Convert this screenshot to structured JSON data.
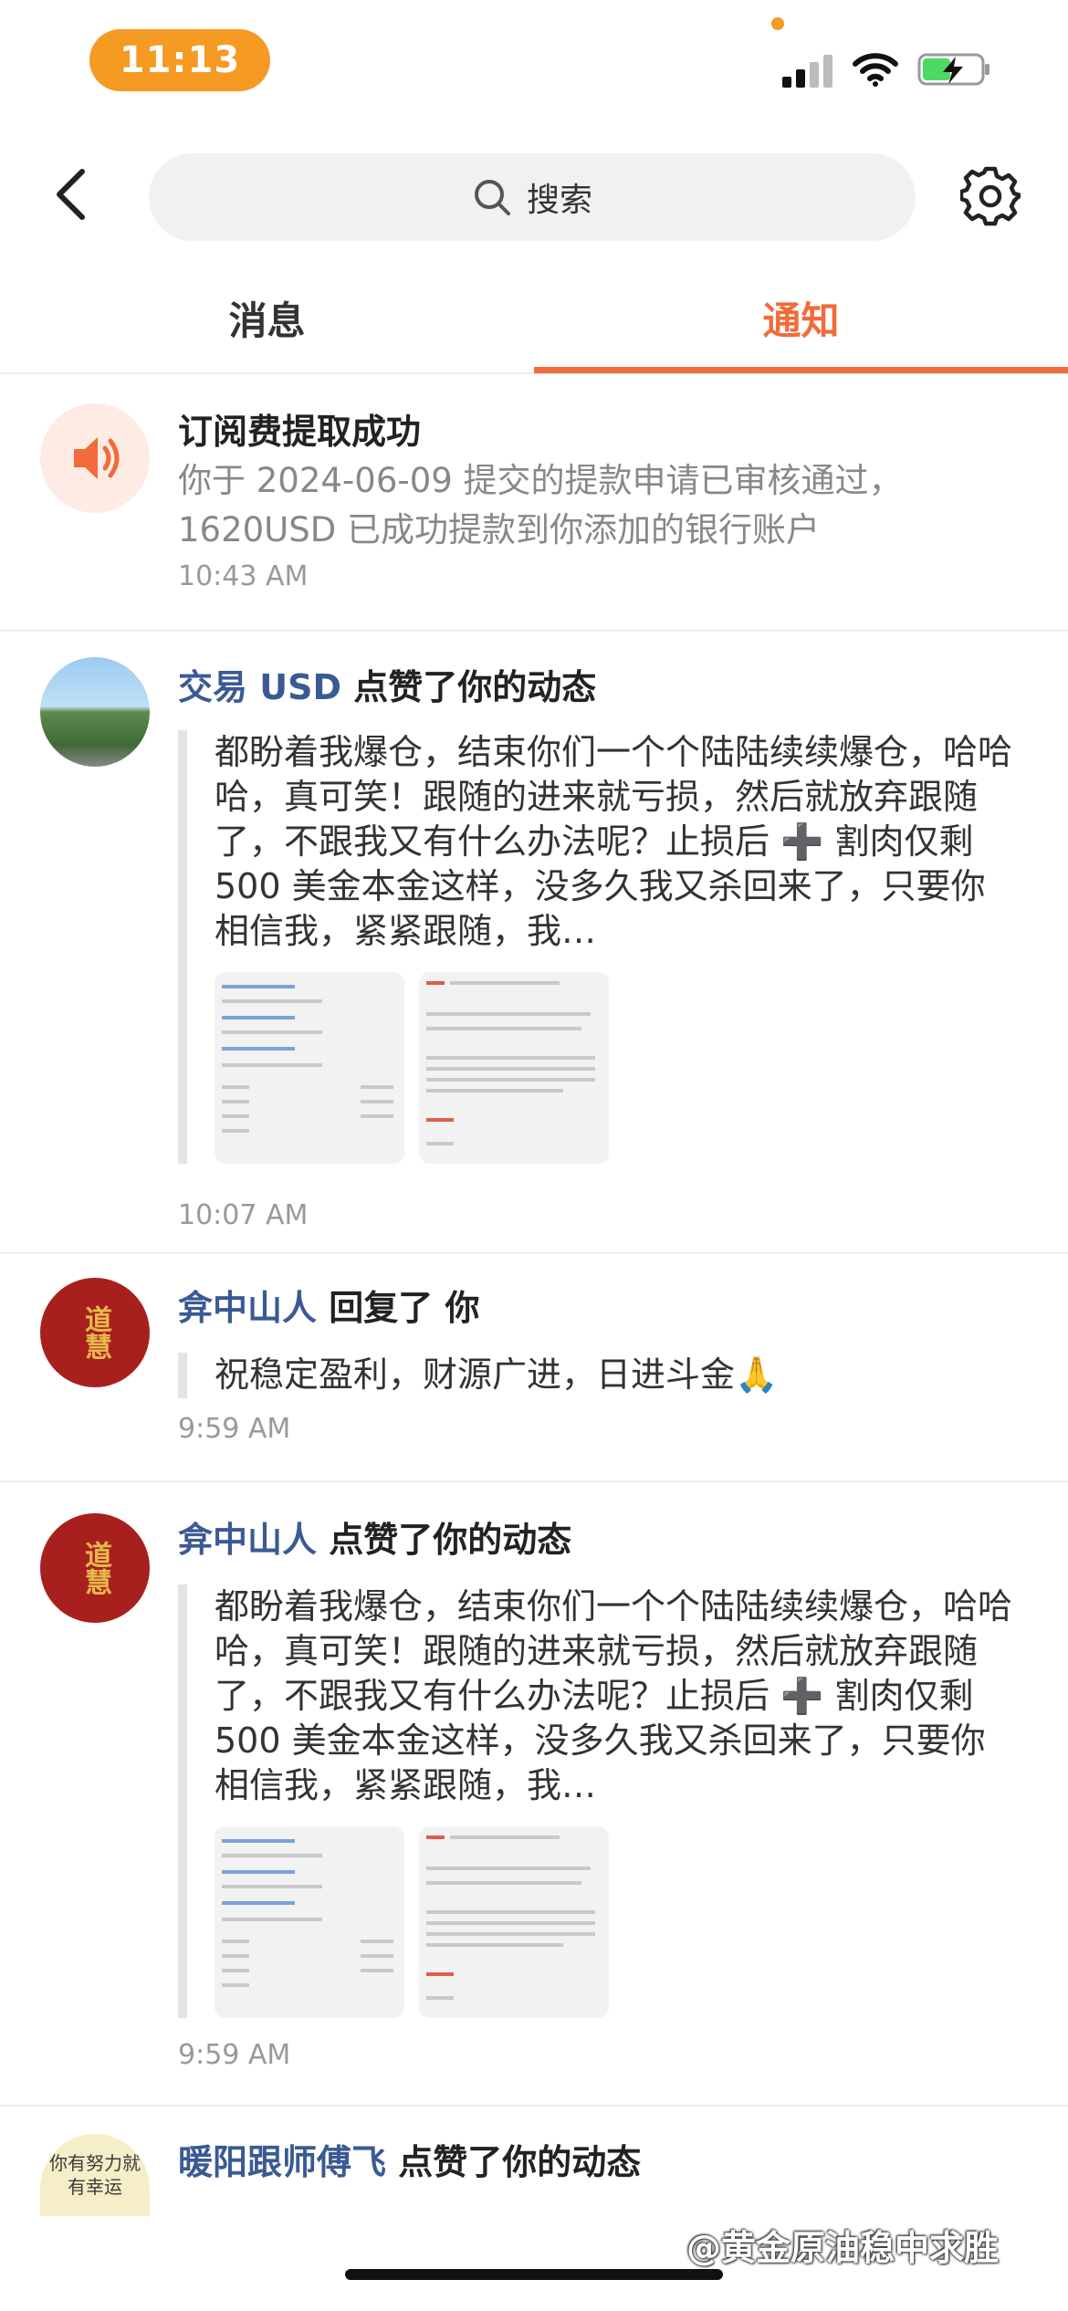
{
  "status_bar": {
    "time": "11:13"
  },
  "search": {
    "placeholder": "搜索"
  },
  "tabs": [
    {
      "label": "消息"
    },
    {
      "label": "通知"
    }
  ],
  "notifications": [
    {
      "title": "订阅费提取成功",
      "body": "你于 2024-06-09 提交的提款申请已审核通过，1620USD 已成功提款到你添加的银行账户",
      "time": "10:43 AM"
    },
    {
      "user": "交易 USD",
      "action": " 点赞了你的动态",
      "quote": "都盼着我爆仓，结束你们一个个陆陆续续爆仓，哈哈哈，真可笑！跟随的进来就亏损，然后就放弃跟随了，不跟我又有什么办法呢？止损后 ➕ 割肉仅剩 500 美金本金这样，没多久我又杀回来了，只要你相信我，紧紧跟随，我…",
      "time": "10:07 AM"
    },
    {
      "user": "弇中山人",
      "action": " 回复了 你",
      "quote": "祝稳定盈利，财源广进，日进斗金🙏",
      "time": "9:59 AM"
    },
    {
      "user": "弇中山人",
      "action": " 点赞了你的动态",
      "quote": "都盼着我爆仓，结束你们一个个陆陆续续爆仓，哈哈哈，真可笑！跟随的进来就亏损，然后就放弃跟随了，不跟我又有什么办法呢？止损后 ➕ 割肉仅剩 500 美金本金这样，没多久我又杀回来了，只要你相信我，紧紧跟随，我…",
      "time": "9:59 AM"
    },
    {
      "user": "暖阳跟师傅飞",
      "action": " 点赞了你的动态",
      "avatar_text": "你有努力就有幸运"
    }
  ],
  "avatar_seal_text": "道慧",
  "watermark": "@黄金原油稳中求胜",
  "colors": {
    "accent": "#f26b3a",
    "username": "#3b5a94",
    "time_pill": "#f59a23"
  }
}
